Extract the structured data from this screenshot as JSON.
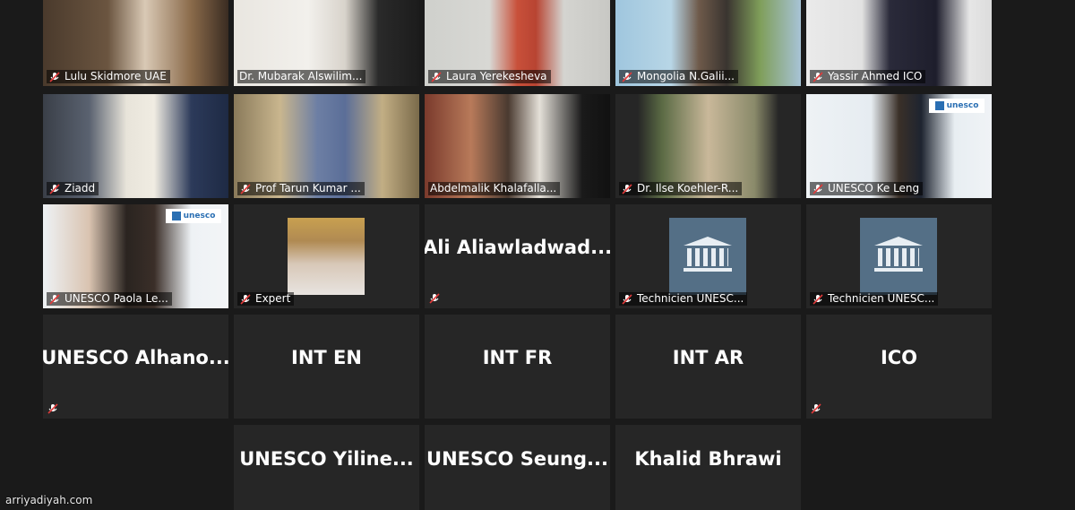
{
  "participants": {
    "p1": "Lulu Skidmore UAE",
    "p2": "Dr. Mubarak Alswilim...",
    "p3": "Laura Yerekesheva",
    "p4": "Mongolia N.Galii...",
    "p5": "Yassir Ahmed ICO",
    "p6": "Ziadd",
    "p7": "Prof Tarun Kumar ...",
    "p8": "Abdelmalik Khalafalla...",
    "p9": "Dr. Ilse Koehler-R...",
    "p10": "UNESCO Ke Leng",
    "p11": "UNESCO Paola Le...",
    "p12": "Expert",
    "p13": "Ali  Aliawladwad...",
    "p14": "Technicien UNESC...",
    "p15": "Technicien UNESC...",
    "p16": "UNESCO  Alhano...",
    "p17": "INT EN",
    "p18": "INT FR",
    "p19": "INT AR",
    "p20": "ICO",
    "p21": "UNESCO  Yiline...",
    "p22": "UNESCO  Seung...",
    "p23": "Khalid Bhrawi"
  },
  "badges": {
    "unesco": "unesco",
    "unesco_logo": "UNESCO"
  },
  "watermark": "arriyadiyah.com",
  "icons": {
    "muted": "muted-mic-icon"
  },
  "colors": {
    "active_border": "#c8d44a",
    "tile_bg": "#262626",
    "mute_red": "#e03a3a"
  }
}
